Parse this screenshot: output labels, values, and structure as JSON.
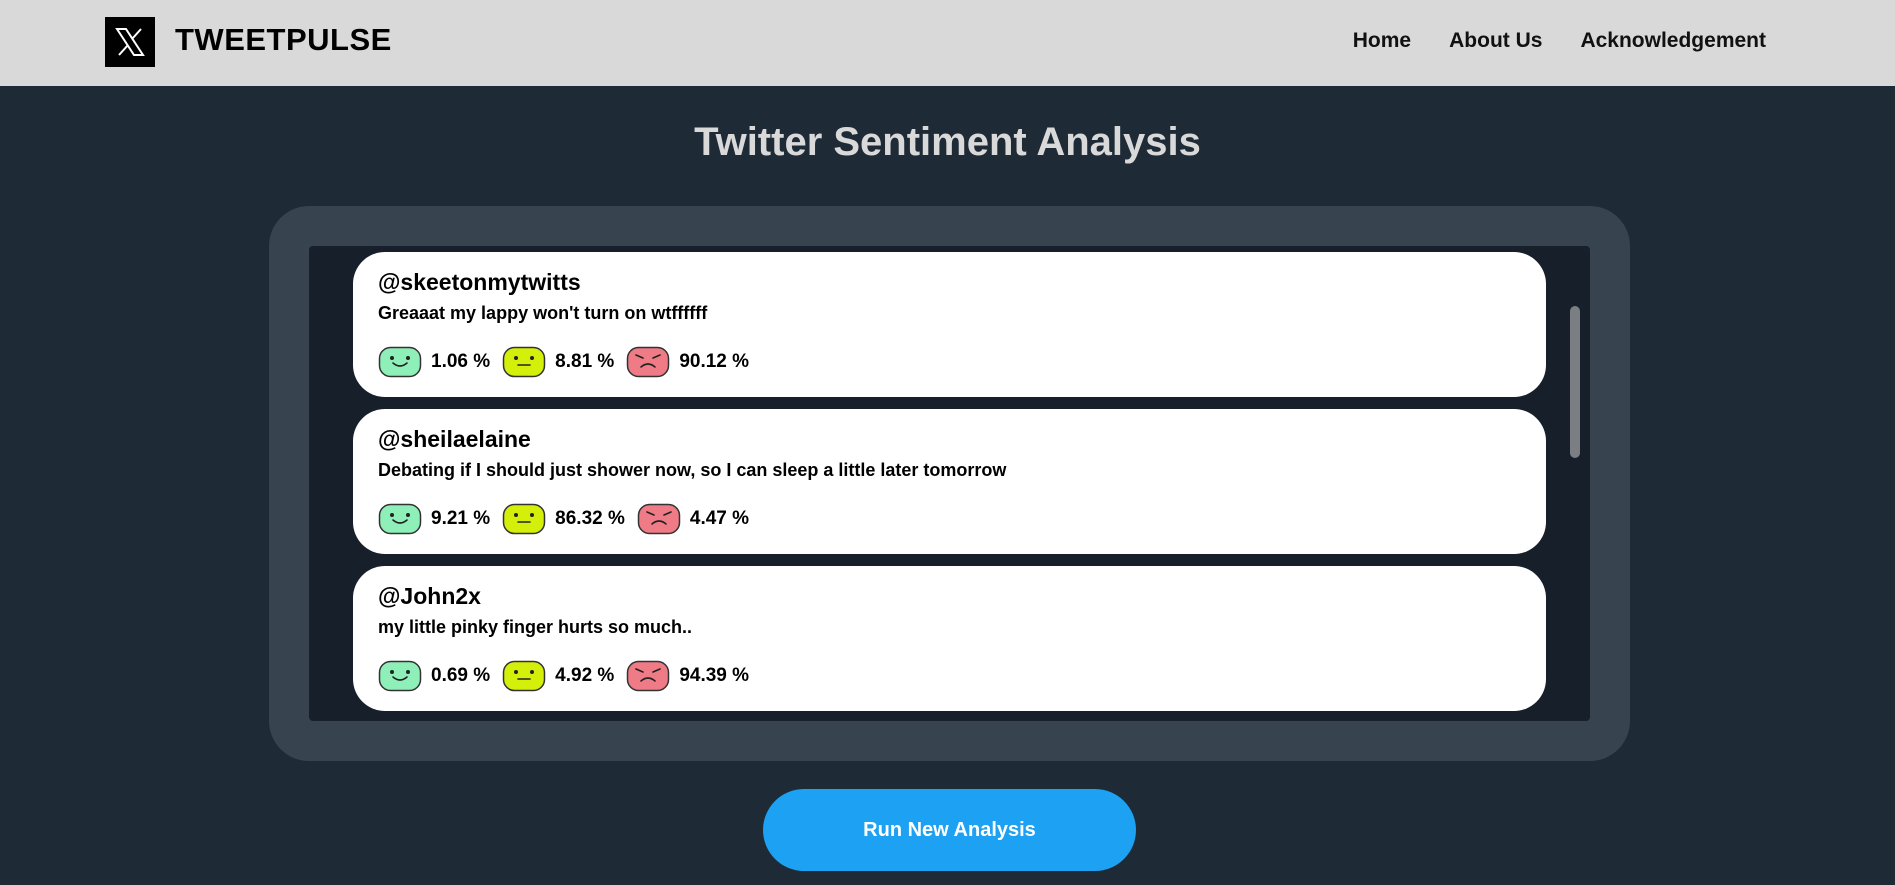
{
  "header": {
    "brand": "TWEETPULSE",
    "logo_icon": "x-logo-icon",
    "nav": {
      "home": "Home",
      "about": "About Us",
      "ack": "Acknowledgement"
    }
  },
  "main": {
    "title": "Twitter Sentiment Analysis",
    "run_button": "Run New Analysis"
  },
  "colors": {
    "positive": "#8ef0b8",
    "neutral": "#d4f00a",
    "negative": "#ef7b86",
    "button": "#1da1f2"
  },
  "tweets": [
    {
      "user": "@skeetonmytwitts",
      "text": "Greaaat my lappy won't turn on wtffffff",
      "positive": "1.06 %",
      "neutral": "8.81 %",
      "negative": "90.12 %"
    },
    {
      "user": "@sheilaelaine",
      "text": "Debating if I should just shower now, so I can sleep a little later tomorrow",
      "positive": "9.21 %",
      "neutral": "86.32 %",
      "negative": "4.47 %"
    },
    {
      "user": "@John2x",
      "text": "my little pinky finger hurts so much..",
      "positive": "0.69 %",
      "neutral": "4.92 %",
      "negative": "94.39 %"
    }
  ]
}
